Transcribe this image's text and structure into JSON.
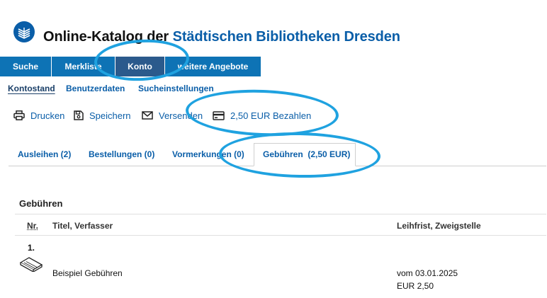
{
  "header": {
    "title_part1": "Online-Katalog der ",
    "title_part2": "Städtischen Bibliotheken Dresden"
  },
  "nav": {
    "items": [
      {
        "label": "Suche"
      },
      {
        "label": "Merkliste"
      },
      {
        "label": "Konto",
        "active": true
      },
      {
        "label": "weitere Angebote"
      }
    ]
  },
  "subnav": {
    "items": [
      {
        "label": "Kontostand",
        "active": true
      },
      {
        "label": "Benutzerdaten"
      },
      {
        "label": "Sucheinstellungen"
      }
    ]
  },
  "actions": {
    "print": "Drucken",
    "save": "Speichern",
    "send": "Versenden",
    "pay": "2,50 EUR Bezahlen"
  },
  "tabs": [
    {
      "label": "Ausleihen (2)"
    },
    {
      "label": "Bestellungen (0)"
    },
    {
      "label": "Vormerkungen (0)"
    },
    {
      "label": "Gebühren  (2,50 EUR)",
      "active": true
    }
  ],
  "section": {
    "title": "Gebühren",
    "columns": {
      "nr": "Nr.",
      "title": "Titel, Verfasser",
      "due": "Leihfrist, Zweigstelle"
    },
    "rows": [
      {
        "nr": "1.",
        "icon": "book-icon",
        "title": "Beispiel Gebühren",
        "date": "vom 03.01.2025",
        "amount": "EUR 2,50"
      }
    ]
  },
  "colors": {
    "nav_blue": "#0e73b5",
    "nav_active": "#2b5a8c",
    "link_blue": "#0a5ea8",
    "annotation": "#1fa2e0"
  }
}
